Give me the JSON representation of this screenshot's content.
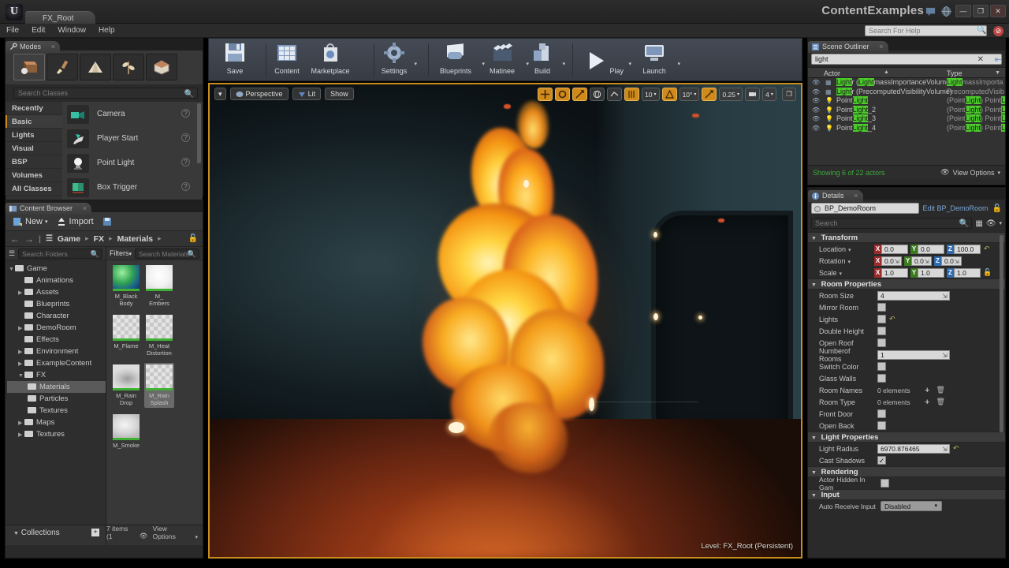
{
  "titlebar": {
    "logo": "ue-logo",
    "document_tab": "FX_Root",
    "app_title": "ContentExamples",
    "icons": [
      "feedback-icon",
      "globe-icon"
    ],
    "window_buttons": {
      "minimize": "—",
      "maximize": "❐",
      "close": "✕"
    }
  },
  "menubar": {
    "items": [
      "File",
      "Edit",
      "Window",
      "Help"
    ],
    "help_search_placeholder": "Search For Help"
  },
  "modes": {
    "tab_label": "Modes",
    "mode_icons": [
      "place-mode-icon",
      "paint-mode-icon",
      "landscape-mode-icon",
      "foliage-mode-icon",
      "geometry-mode-icon"
    ],
    "search_placeholder": "Search Classes",
    "categories": [
      {
        "label": "Recently Placed",
        "state": "normal"
      },
      {
        "label": "Basic",
        "state": "active"
      },
      {
        "label": "Lights",
        "state": "normal"
      },
      {
        "label": "Visual",
        "state": "normal"
      },
      {
        "label": "BSP",
        "state": "normal"
      },
      {
        "label": "Volumes",
        "state": "normal"
      },
      {
        "label": "All Classes",
        "state": "normal"
      }
    ],
    "items": [
      {
        "label": "Camera",
        "icon": "camera-icon"
      },
      {
        "label": "Player Start",
        "icon": "player-start-icon"
      },
      {
        "label": "Point Light",
        "icon": "point-light-icon"
      },
      {
        "label": "Box Trigger",
        "icon": "box-trigger-icon"
      }
    ],
    "help_glyph": "?"
  },
  "content_browser": {
    "tab_label": "Content Browser",
    "new_label": "New",
    "import_label": "Import",
    "save_all_icon": "save-all-icon",
    "breadcrumb": [
      "Game",
      "FX",
      "Materials"
    ],
    "breadcrumb_sep": "▸",
    "folder_search_placeholder": "Search Folders",
    "asset_search_placeholder": "Search Materials",
    "filters_label": "Filters",
    "tree": [
      {
        "label": "Game",
        "depth": 0,
        "expanded": true,
        "has_arrow": true
      },
      {
        "label": "Animations",
        "depth": 1,
        "expanded": false,
        "has_arrow": false
      },
      {
        "label": "Assets",
        "depth": 1,
        "expanded": false,
        "has_arrow": true
      },
      {
        "label": "Blueprints",
        "depth": 1,
        "expanded": false,
        "has_arrow": false
      },
      {
        "label": "Character",
        "depth": 1,
        "expanded": false,
        "has_arrow": false
      },
      {
        "label": "DemoRoom",
        "depth": 1,
        "expanded": false,
        "has_arrow": true
      },
      {
        "label": "Effects",
        "depth": 1,
        "expanded": false,
        "has_arrow": false
      },
      {
        "label": "Environment",
        "depth": 1,
        "expanded": false,
        "has_arrow": true
      },
      {
        "label": "ExampleContent",
        "depth": 1,
        "expanded": false,
        "has_arrow": true
      },
      {
        "label": "FX",
        "depth": 1,
        "expanded": true,
        "has_arrow": true
      },
      {
        "label": "Materials",
        "depth": 2,
        "expanded": false,
        "has_arrow": false,
        "selected": true
      },
      {
        "label": "Particles",
        "depth": 2,
        "expanded": false,
        "has_arrow": false
      },
      {
        "label": "Textures",
        "depth": 2,
        "expanded": false,
        "has_arrow": false
      },
      {
        "label": "Maps",
        "depth": 1,
        "expanded": false,
        "has_arrow": true
      },
      {
        "label": "Textures",
        "depth": 1,
        "expanded": false,
        "has_arrow": true
      }
    ],
    "assets": [
      {
        "name": "M_Black Body",
        "selected": false,
        "thumb": "sphere-green"
      },
      {
        "name": "M_ Embers",
        "selected": false,
        "thumb": "sphere-white"
      },
      {
        "name": "M_Flame",
        "selected": false,
        "thumb": "checker"
      },
      {
        "name": "M_Heat Distortion",
        "selected": false,
        "thumb": "checker"
      },
      {
        "name": "M_Rain Drop",
        "selected": false,
        "thumb": "checker-drop"
      },
      {
        "name": "M_Rain Splash",
        "selected": true,
        "thumb": "checker"
      },
      {
        "name": "M_Smoke",
        "selected": false,
        "thumb": "smoke"
      }
    ],
    "collections_label": "Collections",
    "status_text": "7 items (1",
    "view_options_label": "View Options"
  },
  "toolbar": {
    "groups": [
      [
        {
          "label": "Save",
          "icon": "save-icon",
          "caret": false
        }
      ],
      [
        {
          "label": "Content",
          "icon": "content-icon",
          "caret": false
        },
        {
          "label": "Marketplace",
          "icon": "marketplace-icon",
          "caret": false
        }
      ],
      [
        {
          "label": "Settings",
          "icon": "settings-icon",
          "caret": true
        }
      ],
      [
        {
          "label": "Blueprints",
          "icon": "blueprints-icon",
          "caret": true
        },
        {
          "label": "Matinee",
          "icon": "matinee-icon",
          "caret": true
        },
        {
          "label": "Build",
          "icon": "build-icon",
          "caret": true
        }
      ],
      [
        {
          "label": "Play",
          "icon": "play-icon",
          "caret": true
        },
        {
          "label": "Launch",
          "icon": "launch-icon",
          "caret": true
        }
      ]
    ]
  },
  "viewport": {
    "menu_caret": "▾",
    "perspective_label": "Perspective",
    "lit_label": "Lit",
    "show_label": "Show",
    "level_label": "Level:  FX_Root (Persistent)",
    "right_controls": [
      {
        "name": "translate-mode-button",
        "glyph": "✣",
        "on": true
      },
      {
        "name": "rotate-mode-button",
        "glyph": "◌",
        "on": true
      },
      {
        "name": "scale-mode-button",
        "glyph": "⤡",
        "on": true
      },
      {
        "name": "world-space-button",
        "glyph": "ἱ0",
        "on": false
      },
      {
        "name": "surface-snap-button",
        "glyph": "⬡",
        "on": false
      },
      {
        "name": "grid-snap-toggle",
        "glyph": "☰",
        "on": true
      },
      {
        "name": "grid-snap-value",
        "glyph": "10",
        "on": false
      },
      {
        "name": "angle-snap-toggle",
        "glyph": "△",
        "on": true
      },
      {
        "name": "angle-snap-value",
        "glyph": "10°",
        "on": false
      },
      {
        "name": "scale-snap-toggle",
        "glyph": "↗",
        "on": true
      },
      {
        "name": "scale-snap-value",
        "glyph": "0.25",
        "on": false
      },
      {
        "name": "camera-speed-toggle",
        "glyph": "▣",
        "on": false
      },
      {
        "name": "camera-speed-value",
        "glyph": "4",
        "on": false
      }
    ],
    "maximize_glyph": "❐"
  },
  "outliner": {
    "tab_label": "Scene Outliner",
    "search_value": "light",
    "clear_glyph": "✕",
    "pin_glyph": "⇲",
    "col_actor": "Actor",
    "col_type": "Type",
    "rows": [
      {
        "name_parts": [
          {
            "t": "Light",
            "h": true
          },
          {
            "t": "r (",
            "h": false
          },
          {
            "t": "Light",
            "h": true
          },
          {
            "t": "massImportanceVolume)",
            "h": false
          }
        ],
        "type_parts": [
          {
            "t": "Light",
            "h": true
          },
          {
            "t": "massImporta",
            "h": false
          }
        ],
        "icon": "volume-icon"
      },
      {
        "name_parts": [
          {
            "t": "Light",
            "h": true
          },
          {
            "t": "r (PrecomputedVisibilityVolume)",
            "h": false
          }
        ],
        "type_parts": [
          {
            "t": "PrecomputedVisib",
            "h": false
          }
        ],
        "icon": "volume-icon"
      },
      {
        "name_parts": [
          {
            "t": "Point",
            "h": false
          },
          {
            "t": "Light",
            "h": true
          }
        ],
        "type_parts": [
          {
            "t": "(Point",
            "h": false
          },
          {
            "t": "Light",
            "h": true
          },
          {
            "t": ") Point",
            "h": false
          },
          {
            "t": "Light",
            "h": true
          }
        ],
        "icon": "light-icon"
      },
      {
        "name_parts": [
          {
            "t": "Point",
            "h": false
          },
          {
            "t": "Light",
            "h": true
          },
          {
            "t": "_2",
            "h": false
          }
        ],
        "type_parts": [
          {
            "t": "(Point",
            "h": false
          },
          {
            "t": "Light",
            "h": true
          },
          {
            "t": ") Point",
            "h": false
          },
          {
            "t": "Light",
            "h": true
          }
        ],
        "icon": "light-icon"
      },
      {
        "name_parts": [
          {
            "t": "Point",
            "h": false
          },
          {
            "t": "Light",
            "h": true
          },
          {
            "t": "_3",
            "h": false
          }
        ],
        "type_parts": [
          {
            "t": "(Point",
            "h": false
          },
          {
            "t": "Light",
            "h": true
          },
          {
            "t": ") Point",
            "h": false
          },
          {
            "t": "Light",
            "h": true
          }
        ],
        "icon": "light-icon"
      },
      {
        "name_parts": [
          {
            "t": "Point",
            "h": false
          },
          {
            "t": "Light",
            "h": true
          },
          {
            "t": "_4",
            "h": false
          }
        ],
        "type_parts": [
          {
            "t": "(Point",
            "h": false
          },
          {
            "t": "Light",
            "h": true
          },
          {
            "t": ") Point",
            "h": false
          },
          {
            "t": "Light",
            "h": true
          }
        ],
        "icon": "light-icon"
      }
    ],
    "status": "Showing 6 of 22 actors",
    "view_options": "View Options"
  },
  "details": {
    "tab_label": "Details",
    "actor_name": "BP_DemoRoom",
    "edit_link": "Edit BP_DemoRoom",
    "search_placeholder": "Search",
    "sections": {
      "transform": {
        "title": "Transform",
        "rows": [
          {
            "label": "Location",
            "x": "0.0",
            "y": "0.0",
            "z": "100.0",
            "spin": false,
            "revert": true
          },
          {
            "label": "Rotation",
            "x": "0.0",
            "y": "0.0",
            "z": "0.0",
            "spin": true,
            "revert": false
          },
          {
            "label": "Scale",
            "x": "1.0",
            "y": "1.0",
            "z": "1.0",
            "spin": false,
            "revert": false
          }
        ]
      },
      "room_properties": {
        "title": "Room Properties",
        "rows": [
          {
            "label": "Room Size",
            "type": "number",
            "value": "4"
          },
          {
            "label": "Mirror Room",
            "type": "checkbox",
            "checked": false
          },
          {
            "label": "Lights",
            "type": "checkbox",
            "checked": false,
            "revert": true
          },
          {
            "label": "Double Height",
            "type": "checkbox",
            "checked": false
          },
          {
            "label": "Open Roof",
            "type": "checkbox",
            "checked": false
          },
          {
            "label": "Numberof Rooms",
            "type": "number",
            "value": "1"
          },
          {
            "label": "Switch Color",
            "type": "checkbox",
            "checked": false
          },
          {
            "label": "Glass Walls",
            "type": "checkbox",
            "checked": false
          },
          {
            "label": "Room Names",
            "type": "array",
            "value": "0 elements"
          },
          {
            "label": "Room Type",
            "type": "array",
            "value": "0 elements"
          },
          {
            "label": "Front Door",
            "type": "checkbox",
            "checked": false
          },
          {
            "label": "Open Back",
            "type": "checkbox",
            "checked": false
          }
        ]
      },
      "light_properties": {
        "title": "Light Properties",
        "rows": [
          {
            "label": "Light Radius",
            "type": "number",
            "value": "6970.876465",
            "revert": true
          },
          {
            "label": "Cast Shadows",
            "type": "checkbox",
            "checked": true
          }
        ]
      },
      "rendering": {
        "title": "Rendering",
        "rows": [
          {
            "label": "Actor Hidden In Gam",
            "type": "checkbox",
            "checked": false
          }
        ]
      },
      "input": {
        "title": "Input",
        "rows": [
          {
            "label": "Auto Receive Input",
            "type": "dropdown",
            "value": "Disabled"
          }
        ]
      }
    }
  },
  "colors": {
    "accent_orange": "#d08a1b",
    "highlight_green": "#4bcc2a",
    "status_green": "#3fa83f",
    "link_blue": "#7ba7d7",
    "axis_x": "#9e2b2b",
    "axis_y": "#3d7a1f",
    "axis_z": "#2d6ab0"
  }
}
